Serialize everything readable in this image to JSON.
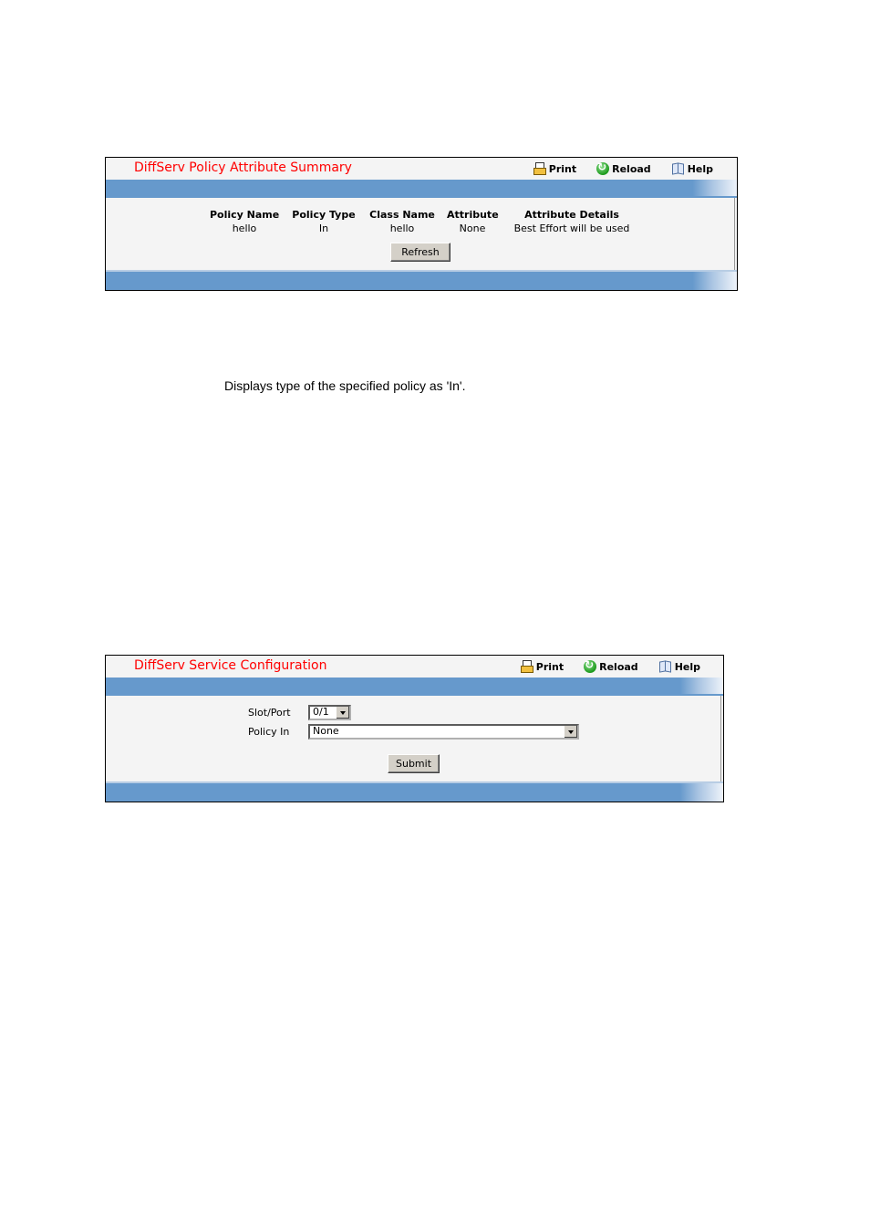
{
  "panel1": {
    "title": "DiffServ Policy Attribute Summary",
    "toolbar": {
      "print": "Print",
      "reload": "Reload",
      "help": "Help"
    },
    "table": {
      "columns": [
        "Policy Name",
        "Policy Type",
        "Class Name",
        "Attribute",
        "Attribute Details"
      ],
      "rows": [
        [
          "hello",
          "In",
          "hello",
          "None",
          "Best Effort will be used"
        ]
      ]
    },
    "refresh_label": "Refresh"
  },
  "description": "Displays type of the specified policy as 'In'.",
  "panel2": {
    "title": "DiffServ Service Configuration",
    "toolbar": {
      "print": "Print",
      "reload": "Reload",
      "help": "Help"
    },
    "slot_port": {
      "label": "Slot/Port",
      "value": "0/1"
    },
    "policy_in": {
      "label": "Policy In",
      "value": "None"
    },
    "submit_label": "Submit"
  },
  "icons": {
    "print": "printer-icon",
    "reload": "reload-icon",
    "help": "book-icon"
  },
  "colors": {
    "title": "#ff0000",
    "bar": "#6699cc",
    "panel_bg": "#f4f4f4"
  }
}
